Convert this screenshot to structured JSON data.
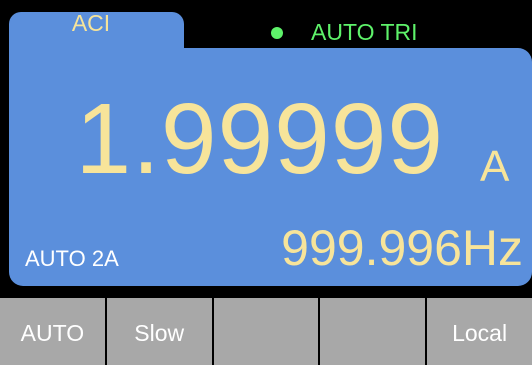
{
  "theme": {
    "panel_color": "#5b8fdc",
    "reading_color": "#f7e49a",
    "label_color": "#ffffff",
    "trigger_color": "#5ef26a",
    "softkey_color": "#a8a8a8",
    "softkey_text_color": "#ffffff"
  },
  "status": {
    "function": "ACI",
    "trigger_icon": "green-dot-icon",
    "trigger": "AUTO TRI"
  },
  "display": {
    "primary_value": "1.99999",
    "primary_unit": "A",
    "range": "AUTO 2A",
    "secondary_value": "999.996Hz"
  },
  "softkeys": [
    {
      "label": "AUTO"
    },
    {
      "label": "Slow"
    },
    {
      "label": ""
    },
    {
      "label": ""
    },
    {
      "label": "Local"
    }
  ]
}
